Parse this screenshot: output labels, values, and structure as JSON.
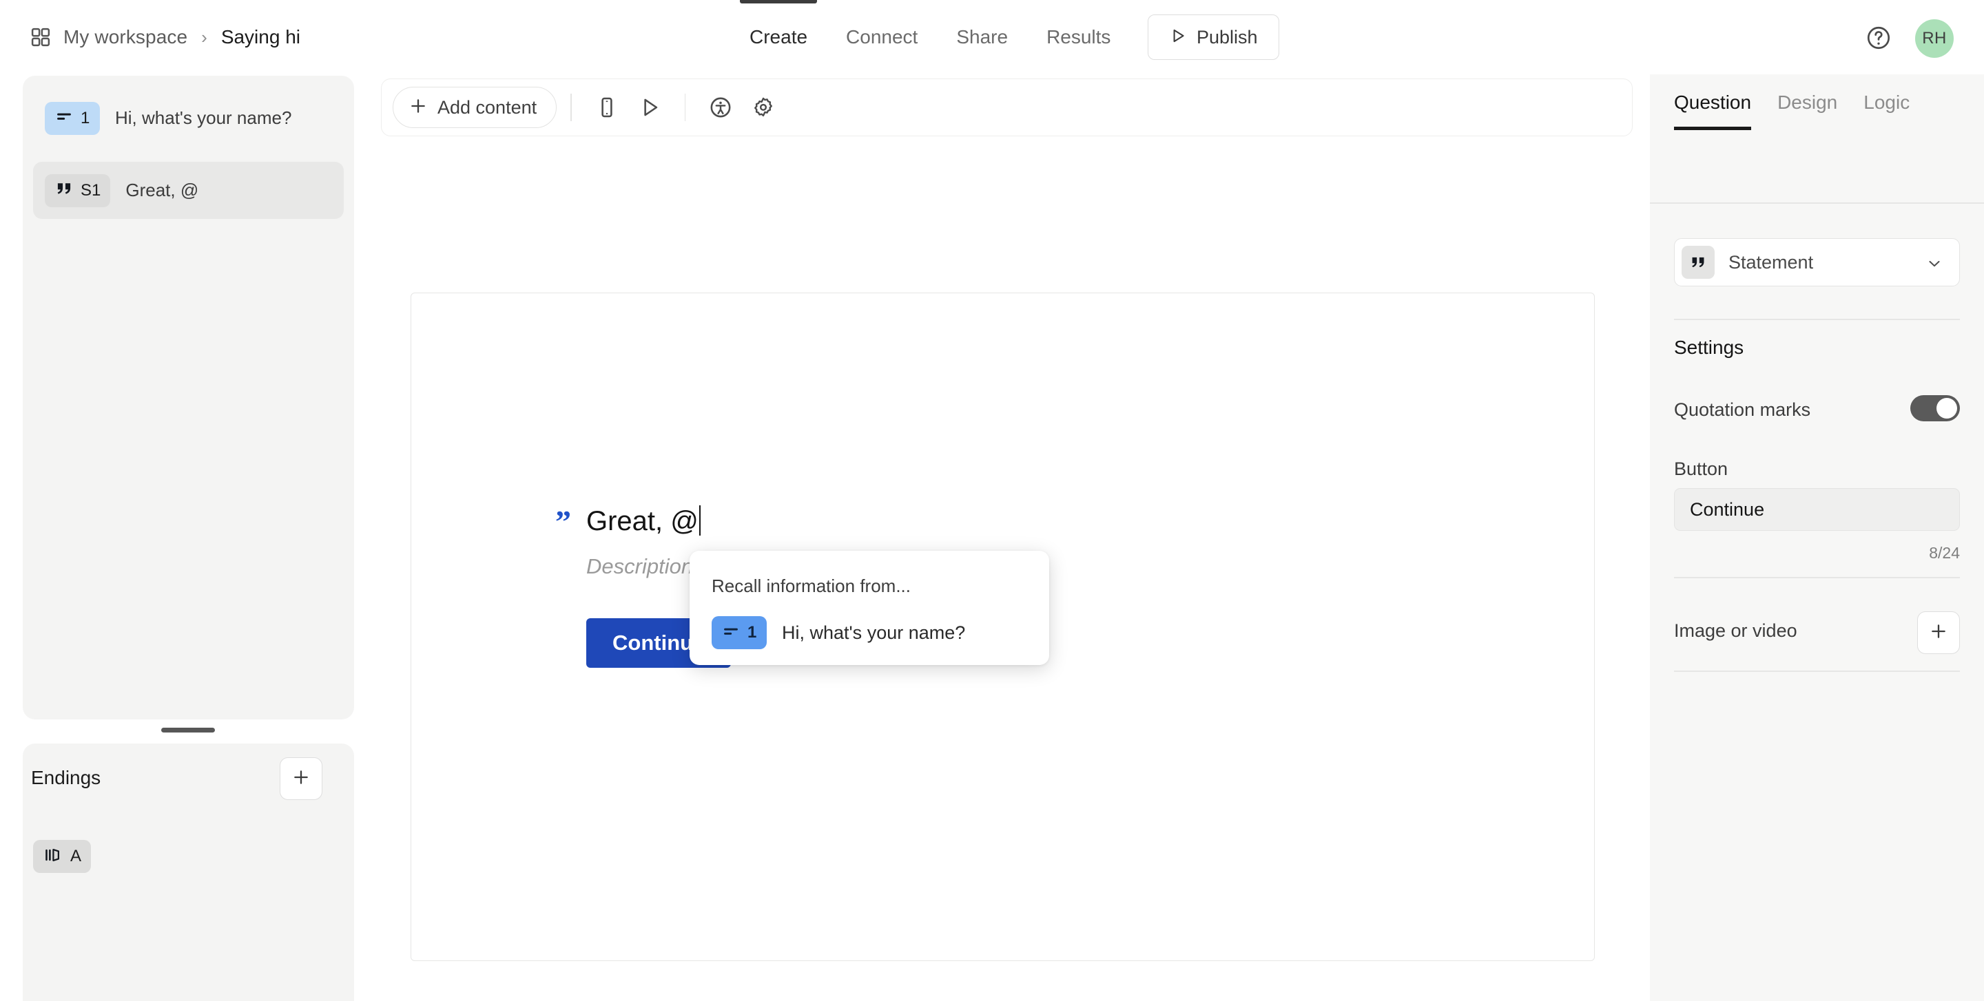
{
  "header": {
    "breadcrumb": {
      "workspace": "My workspace",
      "separator": "›",
      "form_title": "Saying hi",
      "grid_icon": "grid-icon"
    },
    "nav_tabs": [
      {
        "label": "Create",
        "active": true
      },
      {
        "label": "Connect",
        "active": false
      },
      {
        "label": "Share",
        "active": false
      },
      {
        "label": "Results",
        "active": false
      }
    ],
    "publish": {
      "label": "Publish",
      "icon": "play-triangle-icon"
    },
    "help_icon": "help-circle-icon",
    "avatar": {
      "initials": "RH",
      "color": "#abe0b8"
    }
  },
  "sidebar": {
    "questions": [
      {
        "badge_number": "1",
        "badge_icon": "short-text-icon",
        "badge_color": "#bedbf7",
        "label": "Hi, what's your name?",
        "selected": false
      },
      {
        "badge_number": "S1",
        "badge_icon": "quotation-marks-icon",
        "badge_color": "#dcdcdb",
        "label": "Great, @",
        "selected": true
      }
    ],
    "endings": {
      "title": "Endings",
      "add_icon": "plus-icon",
      "items": [
        {
          "badge_number": "A",
          "badge_icon": "ending-flag-icon"
        }
      ]
    }
  },
  "toolbar": {
    "add_content": {
      "label": "Add content",
      "icon": "plus-icon"
    },
    "icons": [
      {
        "name": "mobile-preview-icon"
      },
      {
        "name": "play-preview-icon"
      },
      {
        "name": "accessibility-icon"
      },
      {
        "name": "settings-gear-icon"
      }
    ]
  },
  "canvas": {
    "quote_mark": "”",
    "quote_color": "#2052c9",
    "title": "Great, @",
    "description_placeholder": "Description",
    "button": {
      "label": "Continue",
      "color": "#1f48b8"
    }
  },
  "recall_popup": {
    "title": "Recall information from...",
    "options": [
      {
        "badge_number": "1",
        "badge_icon": "short-text-icon",
        "badge_color": "#5b9bf0",
        "label": "Hi, what's your name?"
      }
    ]
  },
  "right_panel": {
    "tabs": [
      {
        "label": "Question",
        "active": true
      },
      {
        "label": "Design",
        "active": false
      },
      {
        "label": "Logic",
        "active": false
      }
    ],
    "question_type": {
      "value": "Statement",
      "icon": "quotation-marks-icon",
      "chevron": "chevron-down-icon"
    },
    "settings": {
      "heading": "Settings",
      "quotation_marks": {
        "label": "Quotation marks",
        "enabled": true
      },
      "button": {
        "label": "Button",
        "value": "Continue",
        "char_count": "8/24"
      }
    },
    "media": {
      "label": "Image or video",
      "add_icon": "plus-icon"
    }
  }
}
